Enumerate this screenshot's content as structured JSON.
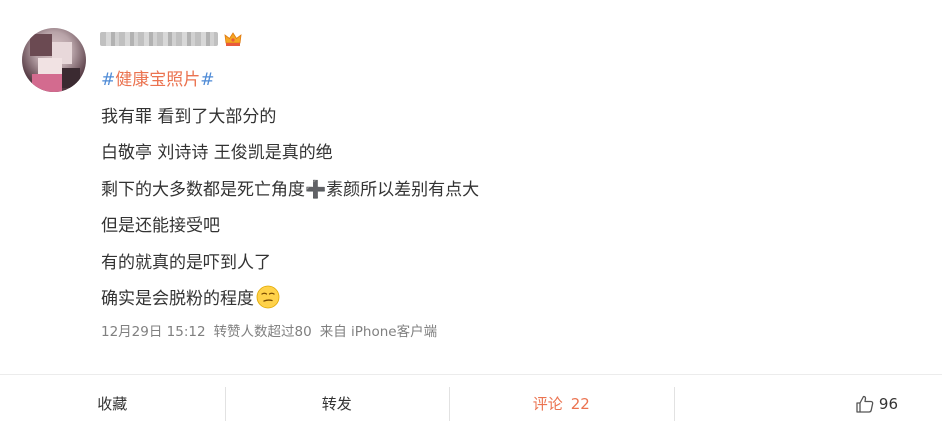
{
  "post": {
    "hashtag_hash_open": "#",
    "hashtag_text": "健康宝照片",
    "hashtag_hash_close": "#",
    "lines": [
      "我有罪 看到了大部分的",
      "白敬亭 刘诗诗 王俊凯是真的绝",
      "剩下的大多数都是死亡角度",
      "素颜所以差别有点大",
      "但是还能接受吧",
      "有的就真的是吓到人了",
      "确实是会脱粉的程度"
    ],
    "plus": "➕",
    "meta": {
      "timestamp": "12月29日 15:12",
      "reposts": "转赞人数超过80",
      "source": "来自 iPhone客户端"
    },
    "icons": {
      "crown": "crown-icon",
      "emoji": "smirk-emoji-icon",
      "like": "thumbs-up-icon"
    }
  },
  "actions": {
    "favorite_label": "收藏",
    "repost_label": "转发",
    "comment_label": "评论",
    "comment_count": "22",
    "like_count": "96"
  },
  "colors": {
    "hashtag_text": "#eb7350",
    "hashtag_hash": "#4f8bd6",
    "meta_text": "#808080",
    "active_action": "#eb7350"
  }
}
